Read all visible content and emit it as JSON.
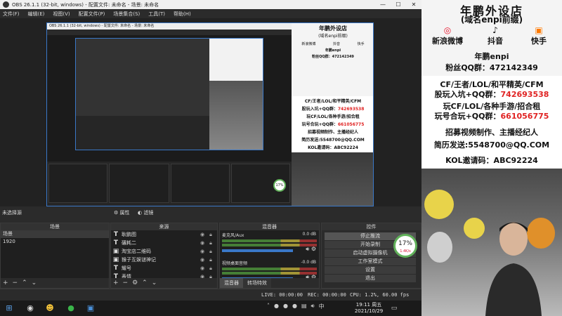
{
  "window": {
    "title": "OBS 26.1.1 (32-bit, windows) - 配置文件: 未命名 - 场景: 未命名",
    "menu": [
      "文件(F)",
      "编辑(E)",
      "视图(V)",
      "配置文件(P)",
      "场景集合(S)",
      "工具(T)",
      "帮助(H)"
    ]
  },
  "info_card": {
    "title": "年鹏外设店",
    "subtitle": "(域名enpi前缀)",
    "socials": [
      {
        "icon": "weibo-icon",
        "label": "新浪微博"
      },
      {
        "icon": "douyin-icon",
        "label": "抖音"
      },
      {
        "icon": "kuaishou-icon",
        "label": "快手"
      }
    ],
    "name_line": "年鹏enpi",
    "qq_label": "粉丝QQ群：",
    "qq_value": "472142349",
    "game_line1": "CF/王者/LOL/和平精英/CFM",
    "game_line2_label": "股玩入坑+QQ群：",
    "game_line2_value": "742693538",
    "game_line3": "玩CF/LOL/各种手游/招合租",
    "game_line4_label": "玩号合玩+QQ群：",
    "game_line4_value": "661056775",
    "recruit_line": "招募视频制作、主播经纪人",
    "resume_line": "简历发送:5548700@QQ.COM",
    "kol_line": "KOL邀请码：ABC92224"
  },
  "obs": {
    "no_source": "未选择源",
    "properties_label": "属性",
    "filters_label": "滤镜",
    "docks": {
      "scenes_title": "场景",
      "sources_title": "来源",
      "mixer_title": "混音器",
      "controls_title": "控件"
    },
    "scenes": [
      "场景",
      "1920"
    ],
    "sources": [
      {
        "icon": "text-icon",
        "name": "耿鹏图"
      },
      {
        "icon": "text-icon",
        "name": "碾耗二"
      },
      {
        "icon": "image-icon",
        "name": "淘宝店二维码"
      },
      {
        "icon": "image-icon",
        "name": "猴子互娱谜神记"
      },
      {
        "icon": "text-icon",
        "name": "耀号"
      },
      {
        "icon": "text-icon",
        "name": "表情"
      }
    ],
    "mixer": [
      {
        "name": "麦克风/Aux",
        "db": "0.0 dB"
      },
      {
        "name": "视频桌面音频",
        "db": "-0.0 dB"
      }
    ],
    "mixer_tabs": [
      "混音器",
      "转场特效"
    ],
    "controls": [
      "停止推流",
      "开始录制",
      "启动虚拟摄像机",
      "工作室模式",
      "设置",
      "退出"
    ],
    "cpu": {
      "percent": "17%",
      "rate": "1.4K/s"
    },
    "status": {
      "live": "LIVE: 00:00:00",
      "rec": "REC: 00:00:00",
      "cpu": "CPU: 1.2%, 60.00 fps"
    }
  },
  "taskbar": {
    "time": "19:11 周五",
    "date": "2021/10/29"
  },
  "colors": {
    "accent_red": "#e02222",
    "selection_blue": "#3a78c8",
    "gauge_green": "#61b15a"
  }
}
